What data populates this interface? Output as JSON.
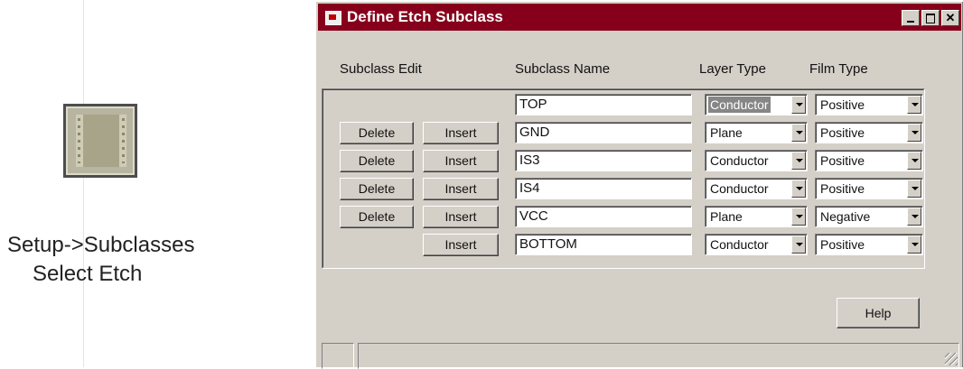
{
  "caption": {
    "line1": "Setup->Subclasses",
    "line2": "Select Etch"
  },
  "icons": {
    "etch": "etch-subclass-icon"
  },
  "dialog": {
    "title": "Define Etch Subclass",
    "headers": {
      "edit": "Subclass Edit",
      "name": "Subclass Name",
      "layer": "Layer Type",
      "film": "Film Type"
    },
    "delete_label": "Delete",
    "insert_label": "Insert",
    "help_label": "Help",
    "rows": [
      {
        "name": "TOP",
        "layer": "Conductor",
        "film": "Positive",
        "delete": false,
        "insert": false,
        "layer_selected": true
      },
      {
        "name": "GND",
        "layer": "Plane",
        "film": "Positive",
        "delete": true,
        "insert": true
      },
      {
        "name": "IS3",
        "layer": "Conductor",
        "film": "Positive",
        "delete": true,
        "insert": true
      },
      {
        "name": "IS4",
        "layer": "Conductor",
        "film": "Positive",
        "delete": true,
        "insert": true
      },
      {
        "name": "VCC",
        "layer": "Plane",
        "film": "Negative",
        "delete": true,
        "insert": true
      },
      {
        "name": "BOTTOM",
        "layer": "Conductor",
        "film": "Positive",
        "delete": false,
        "insert": true
      }
    ]
  },
  "colors": {
    "titlebar": "#86001c",
    "dialog_bg": "#d4d0c8"
  }
}
